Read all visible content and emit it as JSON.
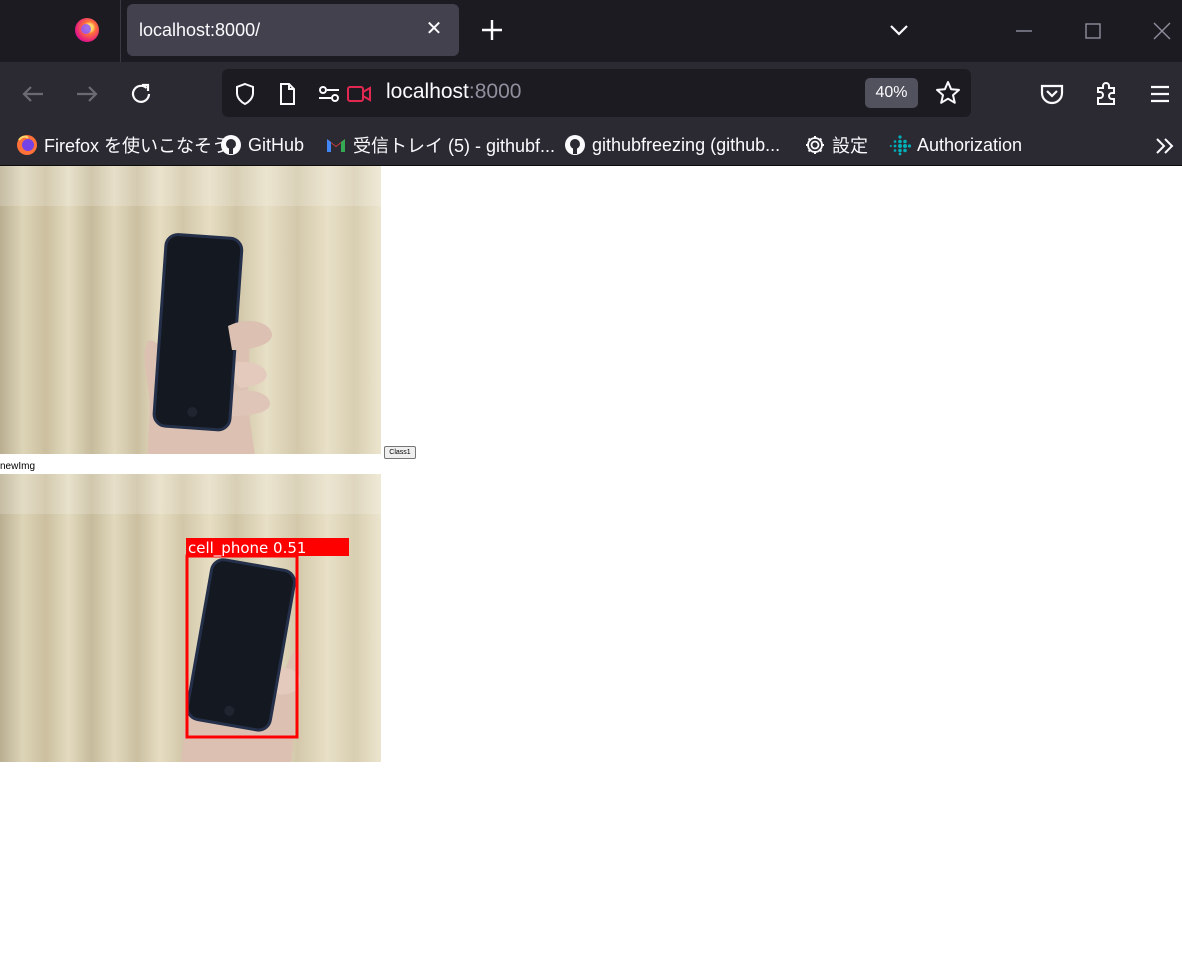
{
  "tab": {
    "title": "localhost:8000/"
  },
  "urlbar": {
    "host": "localhost",
    "port": ":8000",
    "zoom": "40%"
  },
  "bookmarks": [
    {
      "label": "Firefox を使いこなそう",
      "icon": "firefox-icon"
    },
    {
      "label": "GitHub",
      "icon": "github-icon"
    },
    {
      "label": "受信トレイ (5) - githubf...",
      "icon": "gmail-icon"
    },
    {
      "label": "githubfreezing (github...",
      "icon": "github-icon"
    },
    {
      "label": "設定",
      "icon": "gear-icon"
    },
    {
      "label": "Authorization",
      "icon": "fitbit-icon"
    }
  ],
  "page": {
    "class_button_label": "Class1",
    "new_img_label": "newImg",
    "detection": {
      "label": "cell_phone 0.51",
      "class": "cell phone",
      "confidence": 0.51,
      "box_color": "#ff0000"
    }
  },
  "colors": {
    "tabstrip": "#1c1b22",
    "toolbar": "#2b2a33",
    "active_tab": "#42414d",
    "urlbar": "#1c1b22",
    "record_icon": "#e22850"
  }
}
